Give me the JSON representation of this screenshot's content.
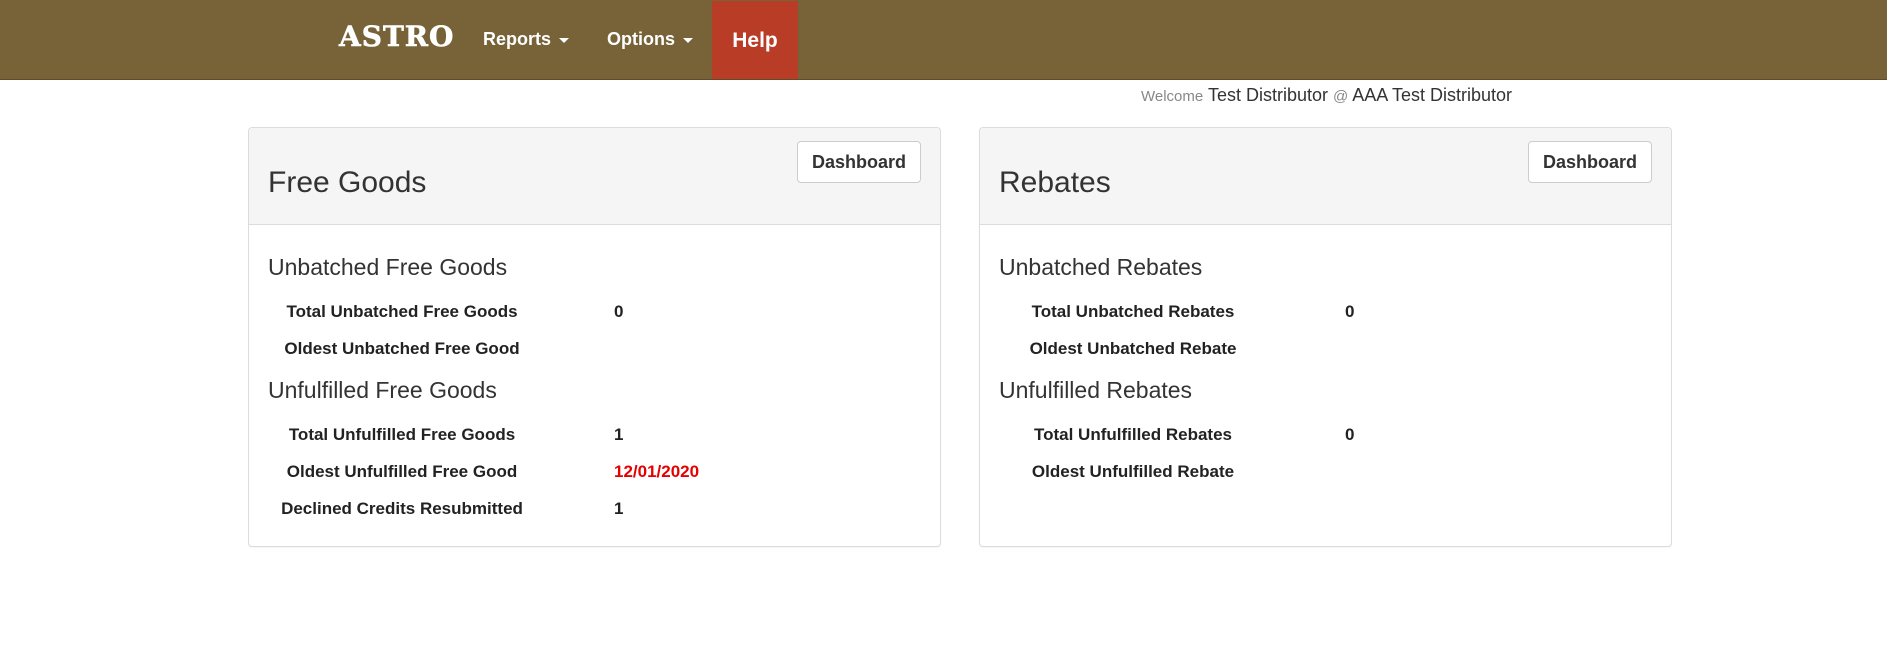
{
  "nav": {
    "logo": "ASTRO",
    "reports_label": "Reports",
    "options_label": "Options",
    "help_label": "Help"
  },
  "welcome": {
    "prefix": "Welcome",
    "user": "Test Distributor",
    "at": "@",
    "company": "AAA Test Distributor"
  },
  "free_goods": {
    "title": "Free Goods",
    "dashboard_label": "Dashboard",
    "unbatched_title": "Unbatched Free Goods",
    "total_unbatched_label": "Total Unbatched Free Goods",
    "total_unbatched_value": "0",
    "oldest_unbatched_label": "Oldest Unbatched Free Good",
    "oldest_unbatched_value": "",
    "unfulfilled_title": "Unfulfilled Free Goods",
    "total_unfulfilled_label": "Total Unfulfilled Free Goods",
    "total_unfulfilled_value": "1",
    "oldest_unfulfilled_label": "Oldest Unfulfilled Free Good",
    "oldest_unfulfilled_value": "12/01/2020",
    "declined_label": "Declined Credits Resubmitted",
    "declined_value": "1"
  },
  "rebates": {
    "title": "Rebates",
    "dashboard_label": "Dashboard",
    "unbatched_title": "Unbatched Rebates",
    "total_unbatched_label": "Total Unbatched Rebates",
    "total_unbatched_value": "0",
    "oldest_unbatched_label": "Oldest Unbatched Rebate",
    "oldest_unbatched_value": "",
    "unfulfilled_title": "Unfulfilled Rebates",
    "total_unfulfilled_label": "Total Unfulfilled Rebates",
    "total_unfulfilled_value": "0",
    "oldest_unfulfilled_label": "Oldest Unfulfilled Rebate",
    "oldest_unfulfilled_value": ""
  },
  "colors": {
    "navbar": "#786339",
    "help": "#b83c26",
    "alert": "#e60000"
  }
}
